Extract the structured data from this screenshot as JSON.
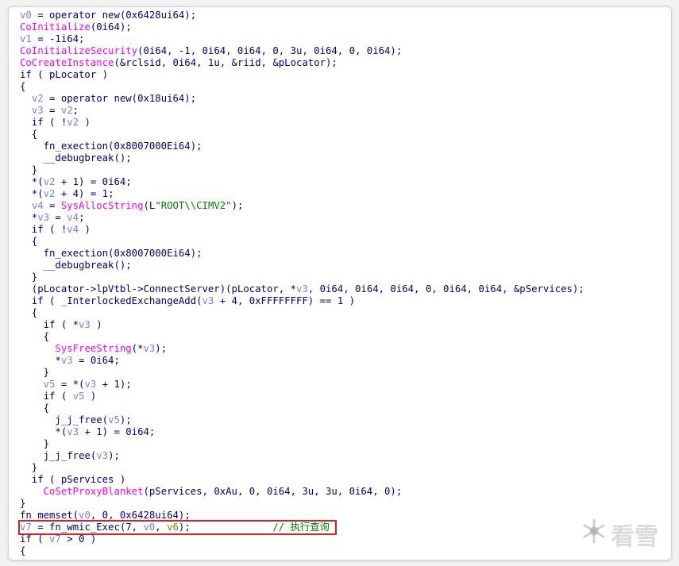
{
  "lines": [
    [
      [
        "v",
        "v0"
      ],
      [
        "n",
        " = operator new(0x6428ui64);"
      ]
    ],
    [
      [
        "f",
        "CoInitialize"
      ],
      [
        "n",
        "(0i64);"
      ]
    ],
    [
      [
        "v",
        "v1"
      ],
      [
        "n",
        " = -1i64;"
      ]
    ],
    [
      [
        "f",
        "CoInitializeSecurity"
      ],
      [
        "n",
        "(0i64, -1, 0i64, 0i64, 0, 3u, 0i64, 0, 0i64);"
      ]
    ],
    [
      [
        "f",
        "CoCreateInstance"
      ],
      [
        "n",
        "(&rclsid, 0i64, 1u, &riid, &pLocator);"
      ]
    ],
    [
      [
        "n",
        "if ( pLocator )"
      ]
    ],
    [
      [
        "n",
        "{"
      ]
    ],
    [
      [
        "n",
        "  "
      ],
      [
        "v",
        "v2"
      ],
      [
        "n",
        " = operator new(0x18ui64);"
      ]
    ],
    [
      [
        "n",
        "  "
      ],
      [
        "v",
        "v3"
      ],
      [
        "n",
        " = "
      ],
      [
        "v",
        "v2"
      ],
      [
        "n",
        ";"
      ]
    ],
    [
      [
        "n",
        "  if ( !"
      ],
      [
        "v",
        "v2"
      ],
      [
        "n",
        " )"
      ]
    ],
    [
      [
        "n",
        "  {"
      ]
    ],
    [
      [
        "n",
        "    fn_exection(0x8007000Ei64);"
      ]
    ],
    [
      [
        "n",
        "    __debugbreak();"
      ]
    ],
    [
      [
        "n",
        "  }"
      ]
    ],
    [
      [
        "n",
        "  *("
      ],
      [
        "v",
        "v2"
      ],
      [
        "n",
        " + 1) = 0i64;"
      ]
    ],
    [
      [
        "n",
        "  *("
      ],
      [
        "v",
        "v2"
      ],
      [
        "n",
        " + 4) = 1;"
      ]
    ],
    [
      [
        "n",
        "  "
      ],
      [
        "v",
        "v4"
      ],
      [
        "n",
        " = "
      ],
      [
        "f",
        "SysAllocString"
      ],
      [
        "n",
        "(L"
      ],
      [
        "s",
        "\"ROOT\\\\CIMV2\""
      ],
      [
        "n",
        ");"
      ]
    ],
    [
      [
        "n",
        "  *"
      ],
      [
        "v",
        "v3"
      ],
      [
        "n",
        " = "
      ],
      [
        "v",
        "v4"
      ],
      [
        "n",
        ";"
      ]
    ],
    [
      [
        "n",
        "  if ( !"
      ],
      [
        "v",
        "v4"
      ],
      [
        "n",
        " )"
      ]
    ],
    [
      [
        "n",
        "  {"
      ]
    ],
    [
      [
        "n",
        "    fn_exection(0x8007000Ei64);"
      ]
    ],
    [
      [
        "n",
        "    __debugbreak();"
      ]
    ],
    [
      [
        "n",
        "  }"
      ]
    ],
    [
      [
        "n",
        "  (pLocator->lpVtbl->ConnectServer)(pLocator, *"
      ],
      [
        "v",
        "v3"
      ],
      [
        "n",
        ", 0i64, 0i64, 0i64, 0, 0i64, 0i64, &pServices);"
      ]
    ],
    [
      [
        "n",
        "  if ( _InterlockedExchangeAdd("
      ],
      [
        "v",
        "v3"
      ],
      [
        "n",
        " + 4, 0xFFFFFFFF) == 1 )"
      ]
    ],
    [
      [
        "n",
        "  {"
      ]
    ],
    [
      [
        "n",
        "    if ( *"
      ],
      [
        "v",
        "v3"
      ],
      [
        "n",
        " )"
      ]
    ],
    [
      [
        "n",
        "    {"
      ]
    ],
    [
      [
        "n",
        "      "
      ],
      [
        "f",
        "SysFreeString"
      ],
      [
        "n",
        "(*"
      ],
      [
        "v",
        "v3"
      ],
      [
        "n",
        ");"
      ]
    ],
    [
      [
        "n",
        "      *"
      ],
      [
        "v",
        "v3"
      ],
      [
        "n",
        " = 0i64;"
      ]
    ],
    [
      [
        "n",
        "    }"
      ]
    ],
    [
      [
        "n",
        "    "
      ],
      [
        "v",
        "v5"
      ],
      [
        "n",
        " = *("
      ],
      [
        "v",
        "v3"
      ],
      [
        "n",
        " + 1);"
      ]
    ],
    [
      [
        "n",
        "    if ( "
      ],
      [
        "v",
        "v5"
      ],
      [
        "n",
        " )"
      ]
    ],
    [
      [
        "n",
        "    {"
      ]
    ],
    [
      [
        "n",
        "      j_j_free("
      ],
      [
        "v",
        "v5"
      ],
      [
        "n",
        ");"
      ]
    ],
    [
      [
        "n",
        "      *("
      ],
      [
        "v",
        "v3"
      ],
      [
        "n",
        " + 1) = 0i64;"
      ]
    ],
    [
      [
        "n",
        "    }"
      ]
    ],
    [
      [
        "n",
        "    j_j_free("
      ],
      [
        "v",
        "v3"
      ],
      [
        "n",
        ");"
      ]
    ],
    [
      [
        "n",
        "  }"
      ]
    ],
    [
      [
        "n",
        "  if ( pServices )"
      ]
    ],
    [
      [
        "n",
        "    "
      ],
      [
        "f",
        "CoSetProxyBlanket"
      ],
      [
        "n",
        "(pServices, 0xAu, 0, 0i64, 3u, 3u, 0i64, 0);"
      ]
    ],
    [
      [
        "n",
        "}"
      ]
    ],
    [
      [
        "n",
        "fn_memset("
      ],
      [
        "v",
        "v0"
      ],
      [
        "n",
        ", 0, 0x6428ui64);"
      ]
    ],
    [
      [
        "v",
        "v7"
      ],
      [
        "n",
        " = fn_wmic_Exec(7, "
      ],
      [
        "v",
        "v0"
      ],
      [
        "n",
        ", "
      ],
      [
        "o",
        "v6"
      ],
      [
        "n",
        ");"
      ],
      [
        "n",
        "              "
      ],
      [
        "c",
        "// 执行查询"
      ]
    ],
    [
      [
        "n",
        "if ( "
      ],
      [
        "v",
        "v7"
      ],
      [
        "n",
        " > 0 )"
      ]
    ],
    [
      [
        "n",
        "{"
      ]
    ]
  ],
  "highlight_line": 43,
  "watermark": {
    "icon": "snowflake-icon",
    "text": "看雪"
  },
  "colors": {
    "variable": "#7a7af5",
    "function": "#ff00ff",
    "normal": "#000080",
    "string": "#008000",
    "comment": "#008000",
    "highlight_border": "#e02020"
  }
}
